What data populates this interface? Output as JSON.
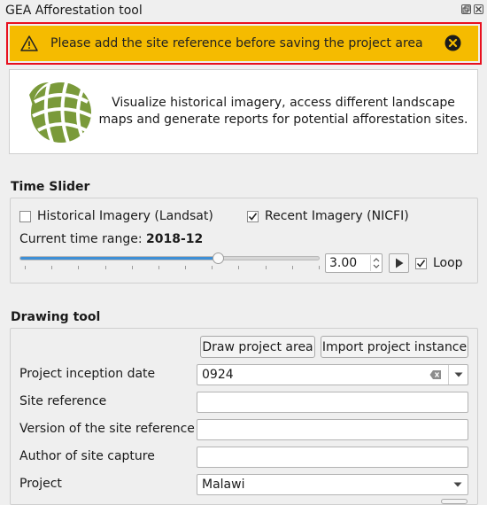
{
  "window": {
    "title": "GEA Afforestation tool"
  },
  "banner": {
    "message": "Please add the site reference before saving the project area",
    "color": "#f5bb00",
    "border_color": "#e8101e"
  },
  "info": {
    "description": "Visualize historical imagery, access different landscape maps and generate reports for potential afforestation sites."
  },
  "time_slider": {
    "title": "Time Slider",
    "historical": {
      "label": "Historical Imagery (Landsat)",
      "checked": false
    },
    "recent": {
      "label": "Recent Imagery (NICFI)",
      "checked": true
    },
    "range_label": "Current time range:",
    "range_value": "2018-12",
    "position": 0.66,
    "speed": "3.00",
    "loop": {
      "label": "Loop",
      "checked": true
    }
  },
  "drawing_tool": {
    "title": "Drawing tool",
    "draw_button": "Draw project area",
    "import_button": "Import project instance",
    "fields": {
      "inception_label": "Project inception date",
      "inception_value": "0924",
      "site_ref_label": "Site reference",
      "site_ref_version_label": "Version of the site reference",
      "author_label": "Author of site capture",
      "project_label": "Project",
      "project_value": "Malawi"
    }
  }
}
